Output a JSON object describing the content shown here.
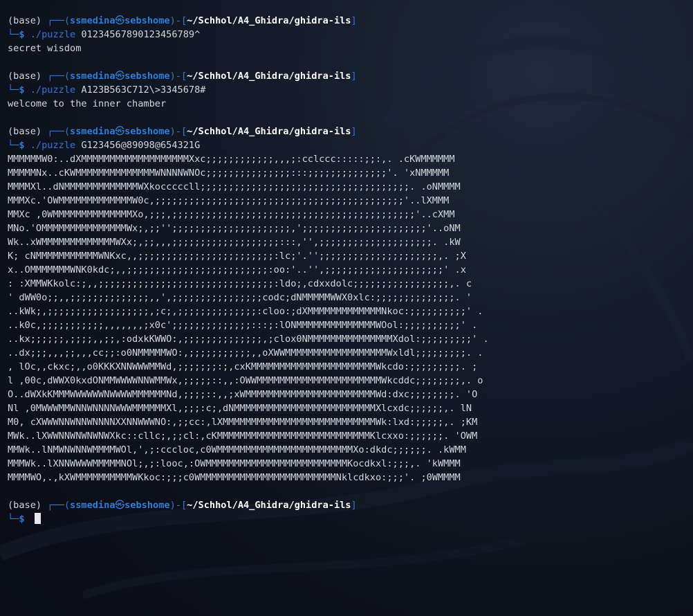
{
  "prompt": {
    "env": "(base)",
    "user": "ssmedina",
    "at_symbol": "㉿",
    "host": "sebshome",
    "path": "~/Schhol/A4_Ghidra/ghidra-ils",
    "top_prefix": " ┌──(",
    "mid": ")-[",
    "close": "]",
    "bottom_prefix": "└─",
    "dollar": "$"
  },
  "sessions": [
    {
      "command": "./puzzle",
      "argument": "01234567890123456789^",
      "output": [
        "secret wisdom"
      ]
    },
    {
      "command": "./puzzle",
      "argument": "A123B563C712\\>3345678#",
      "output": [
        "welcome to the inner chamber"
      ]
    },
    {
      "command": "./puzzle",
      "argument": "G123456@89098@654321G",
      "output": [
        "MMMMMMW0:..dXMMMMMMMMMMMMMMMMMMMXxc;;;;;;;;;;;;,,,;:cclccc:::::;;:,. .cKWMMMMMM",
        "MMMMMNx..cKWMMMMMMMMMMMMMMWNNNNWNOc;;;;;;;;;;;;;;;:::;;;;;;;;;;;;;;'. 'xNMMMMM",
        "MMMMXl..dNMMMMMMMMMMMMMWXkocccccll;;;;;;;;;;;;;;;;;;;;;;;;;;;;;;;;;;;;;. .oNMMMM",
        "MMMXc.'OWMMMMMMMMMMMMMW0c,;;;;;;;;;;;;;;;;;;;;;;;;;;;;;;;;;;;;;;;;;;;;'..lXMMM",
        "MMXc ,0WMMMMMMMMMMMMMMXo,;;;,;;;;;;;;;;;;;;;;;;;;;;;;;;;;;;;;;;;;;;;;;;;'..cXMM",
        "MNo.'OMMMMMMMMMMMMMMMWx;,;;'';;;;;;;;;;;;;;;;;;;;;,';;;;;;;;;;;;;;;;;;;;;;'..oNM",
        "Wk..xWMMMMMMMMMMMMMWXx;,;;,,,;;;;;;;;;;;;;;;;;;;:::,'',;;;;;;;;;;;;;;;;;;;;. .kW",
        "K; cNMMMMMMMMMMMWNKxc,,;;;;;;;;;;;;;;;;;;;;;;;;:lc;'.'';;;;;;;;;;;;;;;;;;;;;,. ;X",
        "x..OMMMMMMMWNK0kdc;,,;;;;;;;;;;;;;;;;;;;;;;;;;:oo:'..'',;;;;;;;;;;;;;;;;;;;;;' .x",
        ": :XMMWKkolc:;,,;;;;;;;;;;;;;;;;;;;;;;;;;;;;;;;:ldo;,cdxxdolc;;;;;;;;;;;;;;;;;,. c",
        "' dWW0o;;,,;;;;;;;;;;;;;;,,',;;;;;;;;;;;;;;;;codc;dNMMMMMWWX0xlc:;;;;;;;;;;;;;;. '",
        "..kWk;,;;;;;;;;;;;;;;;;;;,;c;,;;;;;;;;;;;;;;:cloo:;dXMMMMMMMMMMMMMNkoc:;;;;;;;;;;' .",
        "..k0c,;;;;;;;;;;;,,,,,,,;x0c';;;;;;;;;;;;;;:::;:lONMMMMMMMMMMMMMMWOol:;;;;;;;;;;' .",
        "..kx;;;;;;,;;;;,,;;,:odxkKWWO:,;;;;;;;;;;;;;;,;clox0NMMMMMMMMMMMMMMMXdol:;;;;;;;;;' .",
        "..dx;;;,,,;;,,,cc;;:o0NMMMMMWO:,;;;;;;;;;;;,,oXWWMMMMMMMMMMMMMMMMMMWxldl;;;;;;;;;. .",
        ", lOc,,ckxc;,,o0KKKXNNWWWMMWd,;;;;;;;:;,cxKMMMMMMMMMMMMMMMMMMMMMMWkcdo:;;;;;;;;;. ;",
        "l ,00c,dWWX0kxdONMMWWWWNNWMMWx,;;;;;::,,:OWWMMMMMMMMMMMMMMMMMMMMMMWkcddc;;;;;;;;,. o",
        "O..dWXkKMMMWWWWWWNWWWWMMMMMMNd,;;;;::,,;xWMMMMMMMMMMMMMMMMMMMMMMMWd:dxc;;;;;;;;. 'O",
        "Nl ,0MWWWMMWNNWNNNNWWWMMMMMMXl,;;;:c;,dNMMMMMMMMMMMMMMMMMMMMMMMMMXlcxdc;;;;;;,. lN",
        "M0, cXWWWNNWNNWNNNNXXNNWWWNO:,;;cc:,lXMMMMMMMMMMMMMMMMMMMMMMMMMMMWk:lxd:;;;;;,. ;KM",
        "MWk..lXWWNNWNWNWNWXkc::cllc;,;;cl:,cKMMMMMMMMMMMMMMMMMMMMMMMMMMMKlcxxo:;;;;;;. 'OWM",
        "MMWk..lNMWNWNNWMMMMWOl,',;:cccloc,c0WMMMMMMMMMMMMMMMMMMMMMMMMXo:dkdc;;;;;;. .kWMM",
        "MMMWk..lXNNWWWWMMMMMNOl;,;:looc,:OWMMMMMMMMMMMMMMMMMMMMMMMMMKocdkxl:;;;,. 'kWMMM",
        "MMMMWO,.,kXWMMMMMMMMMMWKkoc:;;;c0WMMMMMMMMMMMMMMMMMMMMMMMMNklcdkxo:;;;'. ;0WMMMM"
      ]
    }
  ],
  "colors": {
    "accent_blue": "#2e76d9",
    "text": "#d4d6dc",
    "background": "#0d111b"
  }
}
